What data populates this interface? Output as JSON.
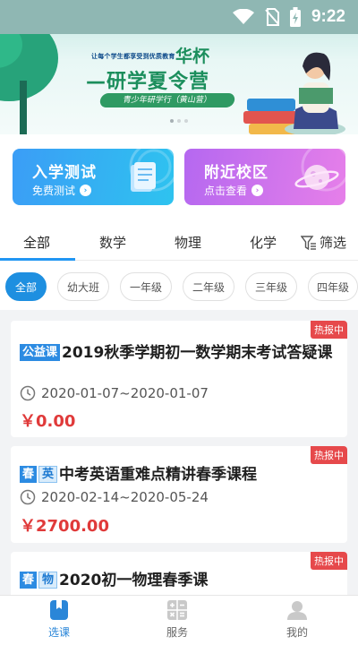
{
  "status_bar": {
    "time": "9:22"
  },
  "banner": {
    "slogan": "让每个学生都享受到优质教育",
    "title_a": "华杯",
    "title_b": "—研学夏令营",
    "ribbon": "青少年研学行（黄山营）"
  },
  "quick_cards": [
    {
      "title": "入学测试",
      "subtitle": "免费测试"
    },
    {
      "title": "附近校区",
      "subtitle": "点击查看"
    }
  ],
  "subject_tabs": [
    "全部",
    "数学",
    "物理",
    "化学"
  ],
  "filter_label": "筛选",
  "grade_chips": [
    "全部",
    "幼大班",
    "一年级",
    "二年级",
    "三年级",
    "四年级"
  ],
  "courses": [
    {
      "tags": [
        "公益课"
      ],
      "title": "2019秋季学期初一数学期末考试答疑课",
      "date": "2020-01-07~2020-01-07",
      "price": "￥0.00",
      "badge": "热报中"
    },
    {
      "tags": [
        "春",
        "英"
      ],
      "title": "中考英语重难点精讲春季课程",
      "date": "2020-02-14~2020-05-24",
      "price": "￥2700.00",
      "badge": "热报中"
    },
    {
      "tags": [
        "春",
        "物"
      ],
      "title": "2020初一物理春季课",
      "badge": "热报中"
    }
  ],
  "bottom_nav": [
    "选课",
    "服务",
    "我的"
  ],
  "colors": {
    "accent": "#2196f3",
    "price": "#e03a3a",
    "hot_badge": "#e6494b"
  }
}
